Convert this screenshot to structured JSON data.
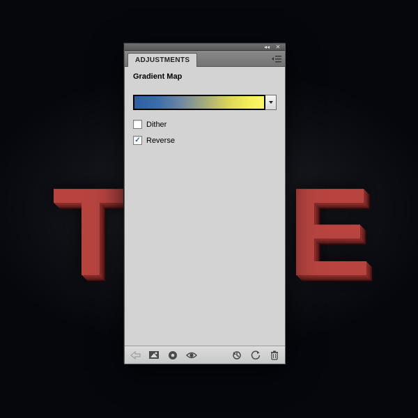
{
  "panel": {
    "tab_label": "ADJUSTMENTS",
    "title": "Gradient Map",
    "gradient_stops": [
      "#2b5ea5",
      "#fcf768"
    ],
    "options": {
      "dither": {
        "label": "Dither",
        "checked": false
      },
      "reverse": {
        "label": "Reverse",
        "checked": true
      }
    },
    "footer_icons": {
      "back": "back-arrow-icon",
      "defaults": "adjustment-defaults-icon",
      "clip": "clip-to-layer-icon",
      "visibility": "visibility-icon",
      "prev": "previous-state-icon",
      "reset": "reset-icon",
      "trash": "trash-icon"
    },
    "top_controls": {
      "collapse": "collapse-icon",
      "close": "close-icon",
      "flyout": "flyout-menu-icon"
    }
  },
  "background_text": "TE"
}
